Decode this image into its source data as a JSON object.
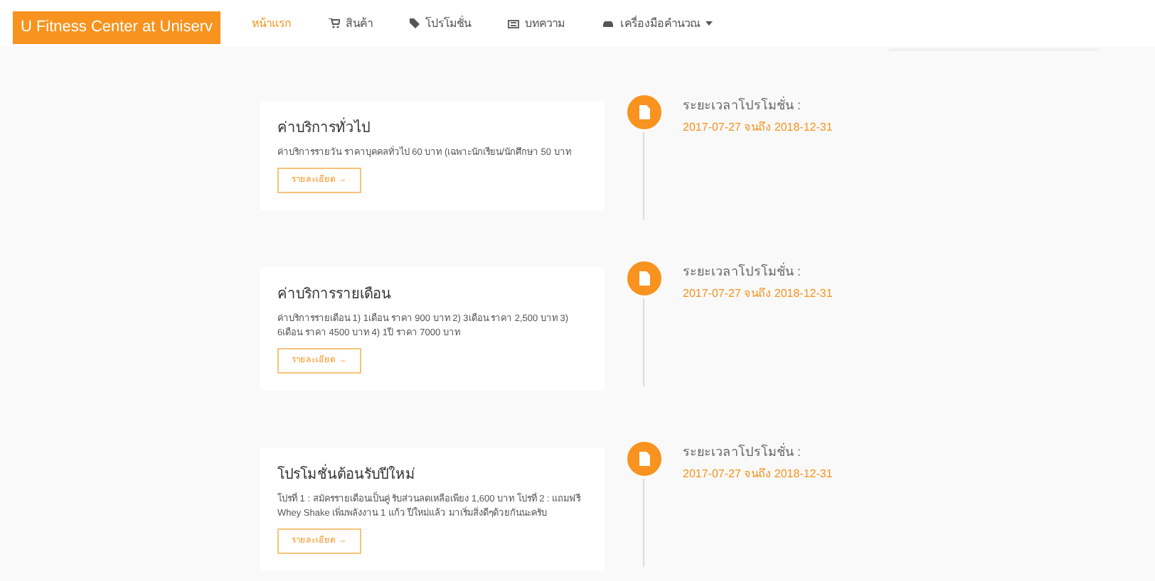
{
  "brand": "U Fitness Center at Uniserv",
  "nav": [
    {
      "label": "หน้าแรก",
      "kind": "plain",
      "selected": true
    },
    {
      "label": "สินค้า",
      "kind": "shop",
      "selected": false
    },
    {
      "label": "โปรโมชั่น",
      "kind": "promo",
      "selected": false
    },
    {
      "label": "บทความ",
      "kind": "article",
      "selected": false
    },
    {
      "label": "เครื่องมือคำนวณ",
      "kind": "tools",
      "selected": false,
      "dropdown": true
    }
  ],
  "promotions": [
    {
      "title": "ค่าบริการทั่วไป",
      "description": "ค่าบริการรายวัน ราคาบุคคลทั่วไป 60 บาท (เฉพาะนักเรียน/นักศึกษา 50 บาท",
      "button": "รายละเอียด →",
      "period_label": "ระยะเวลาโปรโมชั่น :",
      "period": "2017-07-27 จนถึง 2018-12-31"
    },
    {
      "title": "ค่าบริการรายเดือน",
      "description": "ค่าบริการรายเดือน 1) 1เดือน ราคา 900 บาท 2) 3เดือน ราคา 2,500 บาท 3) 6เดือน ราคา 4500 บาท 4) 1ปี ราคา 7000 บาท",
      "button": "รายละเอียด →",
      "period_label": "ระยะเวลาโปรโมชั่น :",
      "period": "2017-07-27 จนถึง 2018-12-31"
    },
    {
      "title": "โปรโมชั่นต้อนรับปีใหม่",
      "description": "โปรที่ 1 : สมัครรายเดือนเป็นคู่ รับส่วนลดเหลือเพียง 1,600 บาท โปรที่ 2 : แถมฟรี Whey Shake เพิ่มพลังงาน 1 แก้ว ปีใหม่แล้ว มาเริ่มสิ่งดีๆด้วยกันนะครับ",
      "button": "รายละเอียด →",
      "period_label": "ระยะเวลาโปรโมชั่น :",
      "period": "2017-07-27 จนถึง 2018-12-31"
    }
  ]
}
